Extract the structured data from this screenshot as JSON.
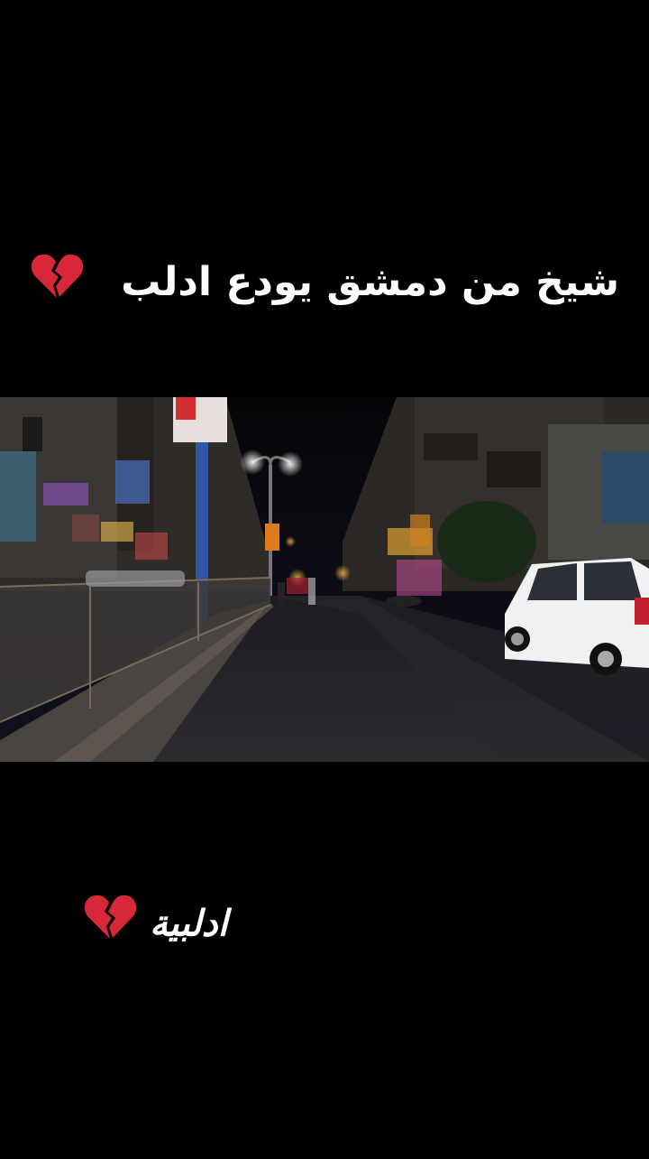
{
  "captions": {
    "top_text": "شيخ من دمشق يودع ادلب",
    "bottom_text": "ادلبية"
  },
  "icons": {
    "heart": "broken-heart-icon"
  },
  "colors": {
    "background": "#000000",
    "text": "#ffffff",
    "heart": "#d62839"
  }
}
